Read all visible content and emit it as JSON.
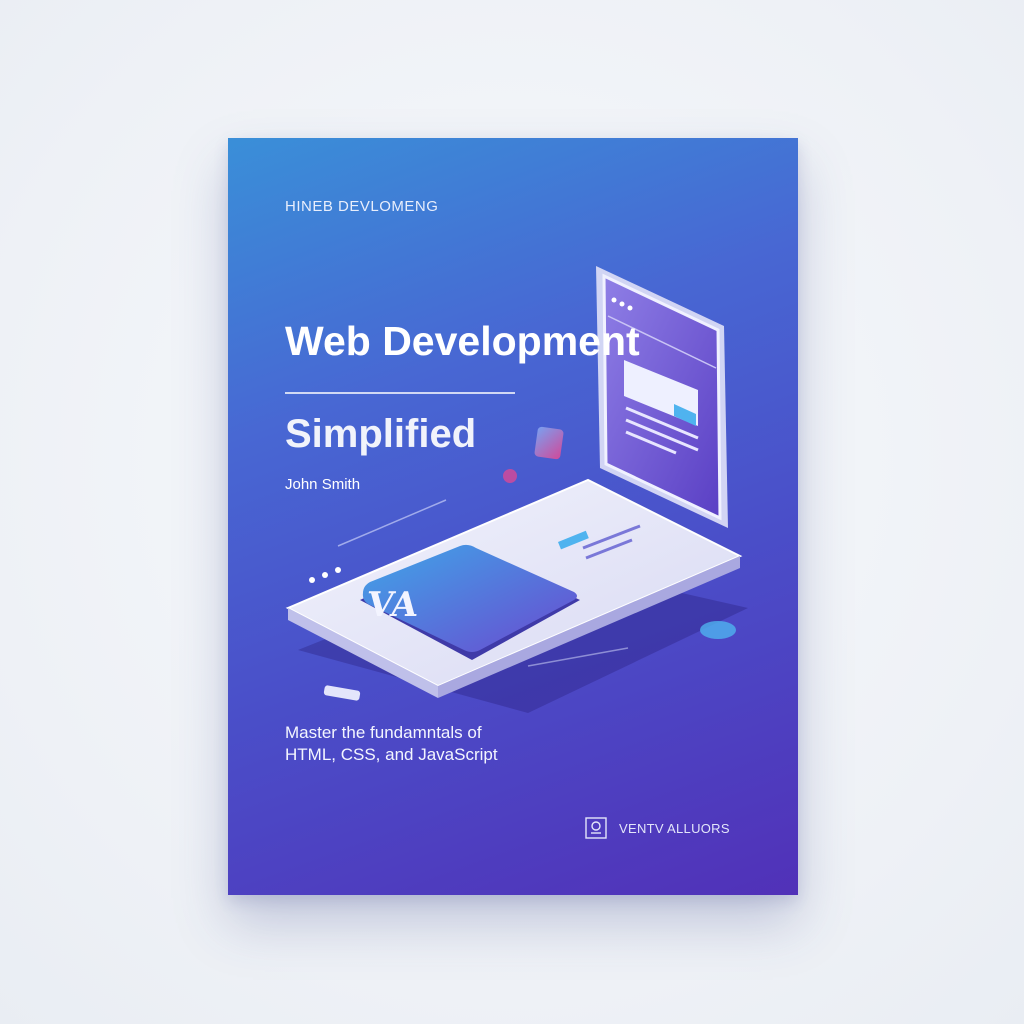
{
  "book": {
    "eyebrow": "HINEB DEVLOMENG",
    "title_line1": "Web Development",
    "title_line2": "Simplified",
    "author": "John Smith",
    "tagline_line1": "Master the fundamntals of",
    "tagline_line2": "HTML, CSS, and JavaScript",
    "publisher": "VENTV ALLUORS",
    "card_logo_text": "VA"
  },
  "colors": {
    "background": "#eef1f6",
    "cover_top": "#3a8fd8",
    "cover_bottom": "#5131b8",
    "device_surface": "#e8e9f8",
    "card_gradient_start": "#3fa6e8",
    "card_gradient_end": "#6a4ad0"
  }
}
